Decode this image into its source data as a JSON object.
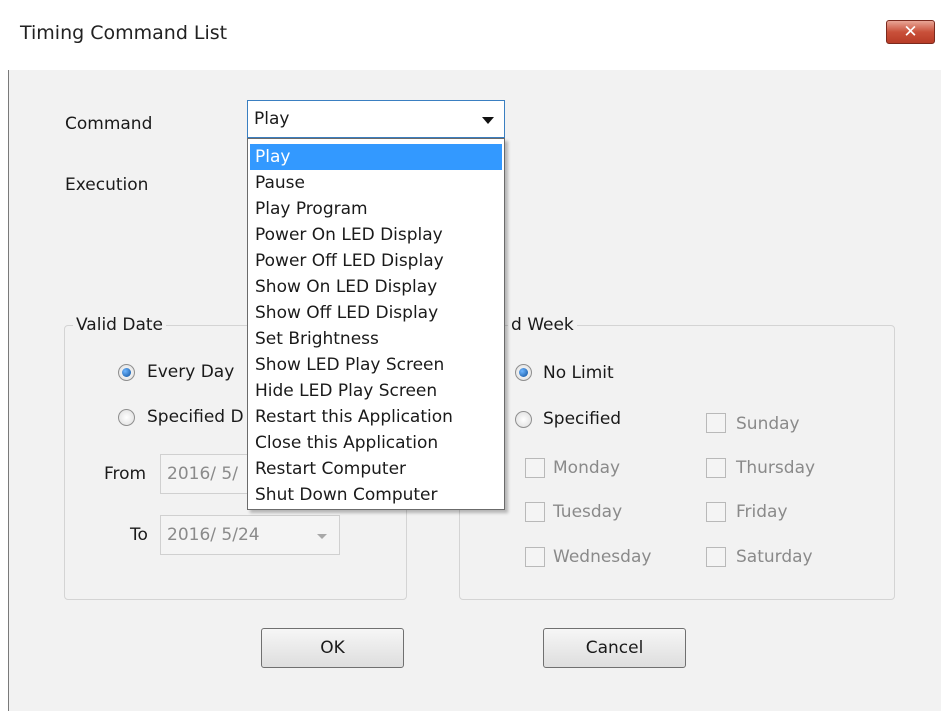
{
  "window": {
    "title": "Timing Command List",
    "close_glyph": "✕"
  },
  "command": {
    "label": "Command",
    "selected": "Play",
    "options": [
      "Play",
      "Pause",
      "Play Program",
      "Power On LED Display",
      "Power Off LED Display",
      "Show On LED Display",
      "Show Off LED Display",
      "Set Brightness",
      "Show LED Play Screen",
      "Hide  LED Play Screen",
      "Restart this Application",
      "Close this Application",
      "Restart Computer",
      "Shut Down Computer"
    ]
  },
  "execution": {
    "label": "Execution"
  },
  "valid_date": {
    "title": "Valid Date",
    "every_day": "Every Day",
    "specified": "Specified D",
    "from_label": "From",
    "to_label": "To",
    "from_value": "2016/  5/",
    "to_value": "2016/  5/24"
  },
  "valid_week": {
    "title": "d Week",
    "no_limit": "No Limit",
    "specified": "Specified",
    "days": {
      "sunday": "Sunday",
      "monday": "Monday",
      "tuesday": "Tuesday",
      "wednesday": "Wednesday",
      "thursday": "Thursday",
      "friday": "Friday",
      "saturday": "Saturday"
    }
  },
  "buttons": {
    "ok": "OK",
    "cancel": "Cancel"
  }
}
